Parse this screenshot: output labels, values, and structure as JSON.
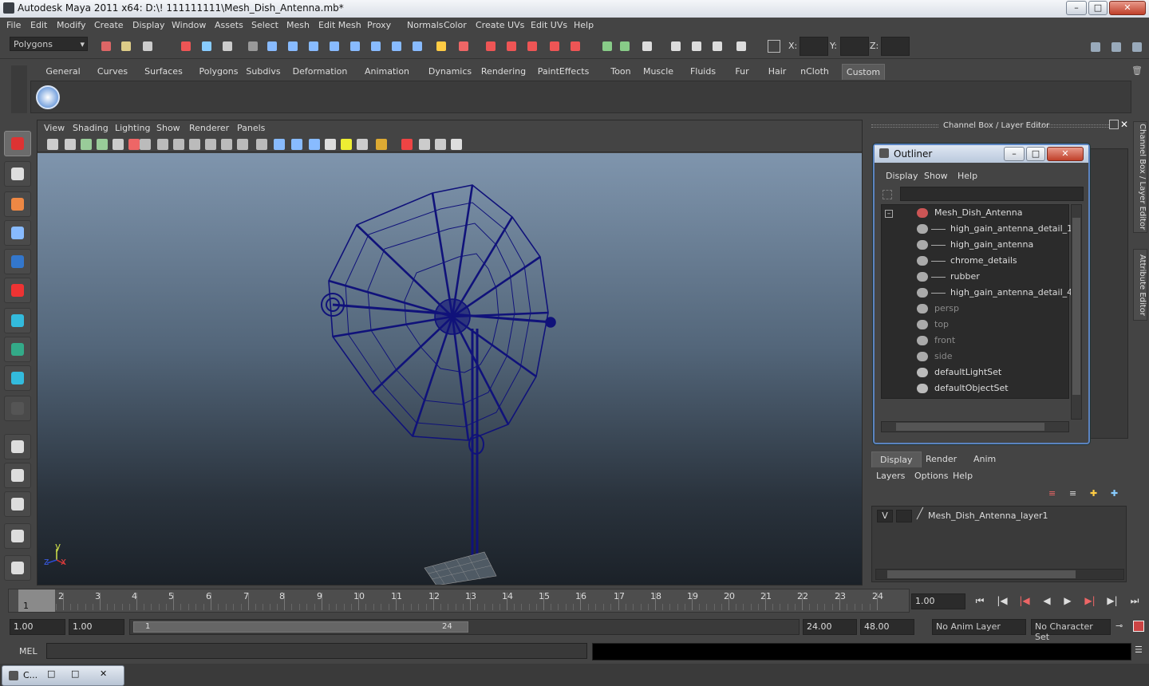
{
  "window": {
    "title": "Autodesk Maya 2011 x64: D:\\! 111111111\\Mesh_Dish_Antenna.mb*",
    "min_label": "–",
    "max_label": "□",
    "close_label": "✕"
  },
  "menubar": [
    "File",
    "Edit",
    "Modify",
    "Create",
    "Display",
    "Window",
    "Assets",
    "Select",
    "Mesh",
    "Edit Mesh",
    "Proxy",
    "Normals",
    "Color",
    "Create UVs",
    "Edit UVs",
    "Help"
  ],
  "status": {
    "mode": "Polygons",
    "x_label": "X:",
    "y_label": "Y:",
    "z_label": "Z:"
  },
  "shelf_tabs": [
    "General",
    "Curves",
    "Surfaces",
    "Polygons",
    "Subdivs",
    "Deformation",
    "Animation",
    "Dynamics",
    "Rendering",
    "PaintEffects",
    "Toon",
    "Muscle",
    "Fluids",
    "Fur",
    "Hair",
    "nCloth",
    "Custom"
  ],
  "shelf_active": "Custom",
  "viewport": {
    "menus": [
      "View",
      "Shading",
      "Lighting",
      "Show",
      "Renderer",
      "Panels"
    ],
    "axis_y": "y",
    "axis_x": "x",
    "axis_z": "z"
  },
  "channel_box": {
    "header": "Channel Box / Layer Editor",
    "side_tab1": "Channel Box / Layer Editor",
    "side_tab2": "Attribute Editor"
  },
  "outliner": {
    "title": "Outliner",
    "menus": [
      "Display",
      "Show",
      "Help"
    ],
    "items": [
      {
        "label": "Mesh_Dish_Antenna",
        "indent": 0,
        "dim": false,
        "icon": "transform-icon"
      },
      {
        "label": "high_gain_antenna_detail_1",
        "indent": 1,
        "dim": false,
        "icon": "mesh-icon"
      },
      {
        "label": "high_gain_antenna",
        "indent": 1,
        "dim": false,
        "icon": "mesh-icon"
      },
      {
        "label": "chrome_details",
        "indent": 1,
        "dim": false,
        "icon": "mesh-icon"
      },
      {
        "label": "rubber",
        "indent": 1,
        "dim": false,
        "icon": "mesh-icon"
      },
      {
        "label": "high_gain_antenna_detail_4",
        "indent": 1,
        "dim": false,
        "icon": "mesh-icon"
      },
      {
        "label": "persp",
        "indent": 0,
        "dim": true,
        "icon": "camera-icon"
      },
      {
        "label": "top",
        "indent": 0,
        "dim": true,
        "icon": "camera-icon"
      },
      {
        "label": "front",
        "indent": 0,
        "dim": true,
        "icon": "camera-icon"
      },
      {
        "label": "side",
        "indent": 0,
        "dim": true,
        "icon": "camera-icon"
      },
      {
        "label": "defaultLightSet",
        "indent": 0,
        "dim": false,
        "icon": "set-icon"
      },
      {
        "label": "defaultObjectSet",
        "indent": 0,
        "dim": false,
        "icon": "set-icon"
      }
    ]
  },
  "layer_editor": {
    "tabs": [
      "Display",
      "Render",
      "Anim"
    ],
    "active_tab": "Display",
    "menus": [
      "Layers",
      "Options",
      "Help"
    ],
    "layer": {
      "visible": "V",
      "name": "Mesh_Dish_Antenna_layer1"
    }
  },
  "timeline": {
    "ticks": [
      "1",
      "2",
      "3",
      "4",
      "5",
      "6",
      "7",
      "8",
      "9",
      "10",
      "11",
      "12",
      "13",
      "14",
      "15",
      "16",
      "17",
      "18",
      "19",
      "20",
      "21",
      "22",
      "23",
      "24"
    ],
    "current_frame_marker": "1",
    "current_time": "1.00"
  },
  "range": {
    "start": "1.00",
    "playback_start": "1.00",
    "slider_start": "1",
    "slider_end": "24",
    "playback_end": "24.00",
    "end": "48.00",
    "anim_layer": "No Anim Layer",
    "character_set": "No Character Set"
  },
  "mel": {
    "label": "MEL"
  },
  "taskbar": {
    "item": "C..."
  },
  "colors": {
    "accent_blue": "#5b83c0",
    "wireframe": "#10127a",
    "bg": "#444444"
  }
}
